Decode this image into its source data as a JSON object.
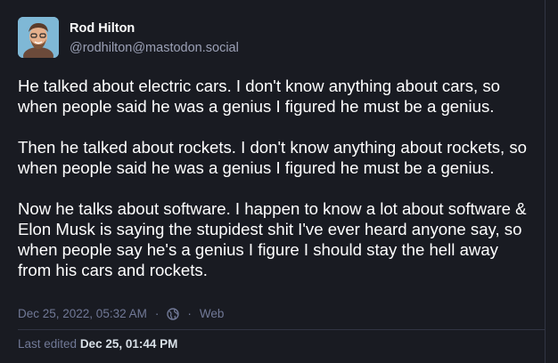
{
  "author": {
    "display_name": "Rod Hilton",
    "handle": "@rodhilton@mastodon.social",
    "avatar_icon": "avatar-portrait"
  },
  "post": {
    "paragraphs": [
      "He talked about electric cars. I don't know anything about cars, so when people said he was a genius I figured he must be a genius.",
      "Then he talked about rockets. I don't know anything about rockets, so when people said he was a genius I figured he must be a genius.",
      "Now he talks about software. I happen to know a lot about software & Elon Musk is saying the stupidest shit I've ever heard anyone say, so when people say he's a genius I figure I should stay the hell away from his cars and rockets."
    ]
  },
  "meta": {
    "timestamp": "Dec 25, 2022, 05:32 AM",
    "separator": "·",
    "visibility_icon": "globe-icon",
    "source": "Web"
  },
  "edited": {
    "label": "Last edited",
    "date": "Dec 25, 01:44 PM"
  },
  "colors": {
    "background": "#191b22",
    "text": "#ffffff",
    "secondary_text": "#9ba0b5",
    "meta_text": "#717997"
  }
}
